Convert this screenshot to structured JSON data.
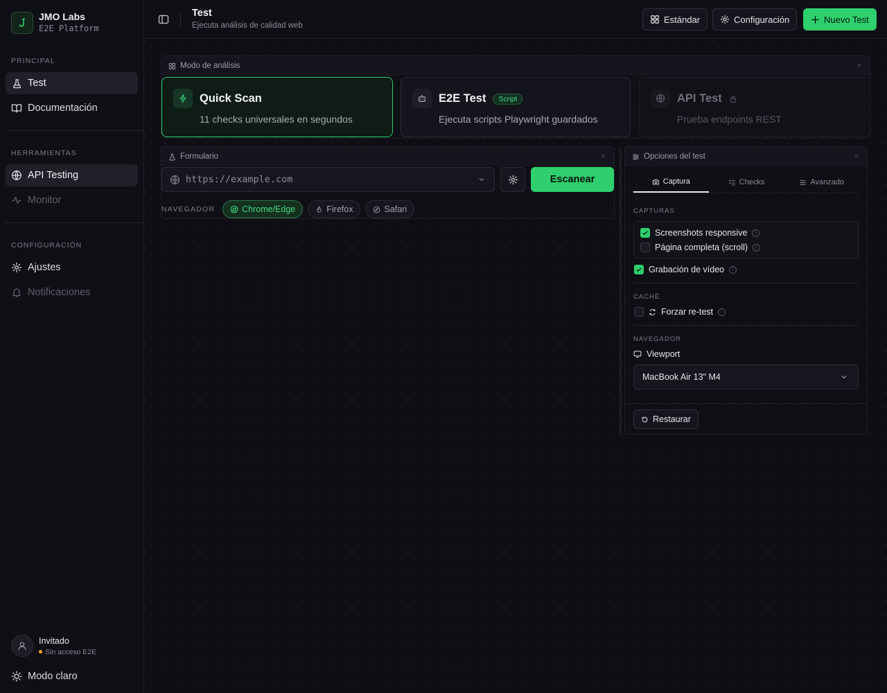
{
  "brand": {
    "name": "JMO Labs",
    "subtitle": "E2E Platform"
  },
  "sidebar": {
    "sections": [
      {
        "label": "PRINCIPAL",
        "items": [
          {
            "label": "Test",
            "icon": "flask-icon",
            "active": true
          },
          {
            "label": "Documentación",
            "icon": "book-icon"
          }
        ]
      },
      {
        "label": "HERRAMIENTAS",
        "items": [
          {
            "label": "API Testing",
            "icon": "globe-icon",
            "active": true
          },
          {
            "label": "Monitor",
            "icon": "activity-icon",
            "disabled": true
          }
        ]
      },
      {
        "label": "CONFIGURACIÓN",
        "items": [
          {
            "label": "Ajustes",
            "icon": "gear-icon"
          },
          {
            "label": "Notificaciones",
            "icon": "bell-icon",
            "disabled": true
          }
        ]
      }
    ],
    "user": {
      "name": "Invitado",
      "status": "Sin acceso E2E",
      "status_color": "#f5a524"
    },
    "theme_toggle": "Modo claro"
  },
  "header": {
    "title": "Test",
    "subtitle": "Ejecuta análisis de calidad web",
    "buttons": {
      "standard": "Estándar",
      "config": "Configuración",
      "new_test": "Nuevo Test"
    }
  },
  "mode_panel": {
    "title": "Modo de análisis",
    "close": "×",
    "cards": [
      {
        "title": "Quick Scan",
        "desc": "11 checks universales en segundos",
        "icon": "bolt-icon",
        "active": true
      },
      {
        "title": "E2E Test",
        "badge": "Script",
        "desc": "Ejecuta scripts Playwright guardados",
        "icon": "bot-icon"
      },
      {
        "title": "API Test",
        "desc": "Prueba endpoints REST",
        "icon": "globe-icon",
        "locked": true
      }
    ]
  },
  "form_panel": {
    "title": "Formulario",
    "close": "×",
    "url_placeholder": "https://example.com",
    "scan_button": "Escanear",
    "browser_label": "NAVEGADOR",
    "browsers": [
      {
        "label": "Chrome/Edge",
        "icon": "chrome-icon",
        "active": true
      },
      {
        "label": "Firefox",
        "icon": "flame-icon"
      },
      {
        "label": "Safari",
        "icon": "compass-icon"
      }
    ]
  },
  "options_panel": {
    "title": "Opciones del test",
    "close": "×",
    "tabs": [
      {
        "label": "Captura",
        "icon": "camera-icon",
        "active": true
      },
      {
        "label": "Checks",
        "icon": "list-check-icon"
      },
      {
        "label": "Avanzado",
        "icon": "sliders-icon"
      }
    ],
    "captures_label": "CAPTURAS",
    "screenshots_responsive": "Screenshots responsive",
    "full_page": "Página completa (scroll)",
    "video": "Grabación de vídeo",
    "cache_label": "CACHÉ",
    "force_retest": "Forzar re-test",
    "browser_label": "NAVEGADOR",
    "viewport_label": "Viewport",
    "viewport_value": "MacBook Air 13\" M4",
    "restore": "Restaurar",
    "checked": {
      "screenshots_responsive": true,
      "full_page": false,
      "video": true,
      "force_retest": false
    }
  },
  "colors": {
    "accent": "#2fcf6e",
    "background": "#0e0e14"
  }
}
